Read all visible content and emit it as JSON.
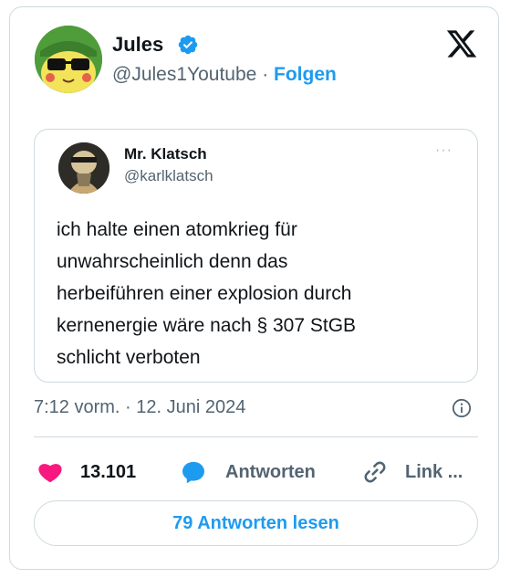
{
  "author": {
    "name": "Jules",
    "handle": "@Jules1Youtube",
    "separator": "·",
    "follow_label": "Folgen"
  },
  "quoted": {
    "name": "Mr. Klatsch",
    "handle": "@karlklatsch",
    "more_label": "···",
    "lines": [
      "ich halte einen atomkrieg für",
      "unwahrscheinlich denn das",
      "herbeiführen einer explosion durch",
      "kernenergie wäre nach § 307 StGB",
      "schlicht verboten"
    ]
  },
  "timestamp": "7:12 vorm. · 12. Juni 2024",
  "actions": {
    "likes": "13.101",
    "reply_label": "Antworten",
    "link_label": "Link ..."
  },
  "read_replies_label": "79 Antworten lesen",
  "colors": {
    "accent": "#1d9bf0",
    "like": "#f91880",
    "border": "#cfd9de",
    "muted": "#536471"
  },
  "icons": [
    "verified-badge-icon",
    "x-logo-icon",
    "more-icon",
    "info-icon",
    "heart-icon",
    "reply-bubble-icon",
    "link-icon"
  ]
}
